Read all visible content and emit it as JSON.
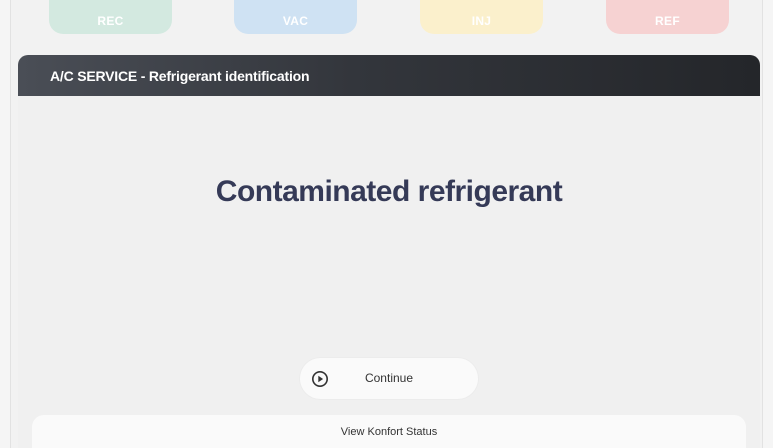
{
  "tabs": [
    {
      "label": "REC",
      "color": "#d3e9e0"
    },
    {
      "label": "VAC",
      "color": "#cfe2f3"
    },
    {
      "label": "INJ",
      "color": "#fbf0cc"
    },
    {
      "label": "REF",
      "color": "#f6d2d2"
    }
  ],
  "panel": {
    "title": "A/C SERVICE - Refrigerant identification",
    "message": "Contaminated refrigerant",
    "continue_label": "Continue",
    "continue_icon": "play-circle-icon"
  },
  "footer": {
    "status_label": "View Konfort Status"
  },
  "colors": {
    "header": "#2b2e33",
    "headline": "#353a57"
  }
}
